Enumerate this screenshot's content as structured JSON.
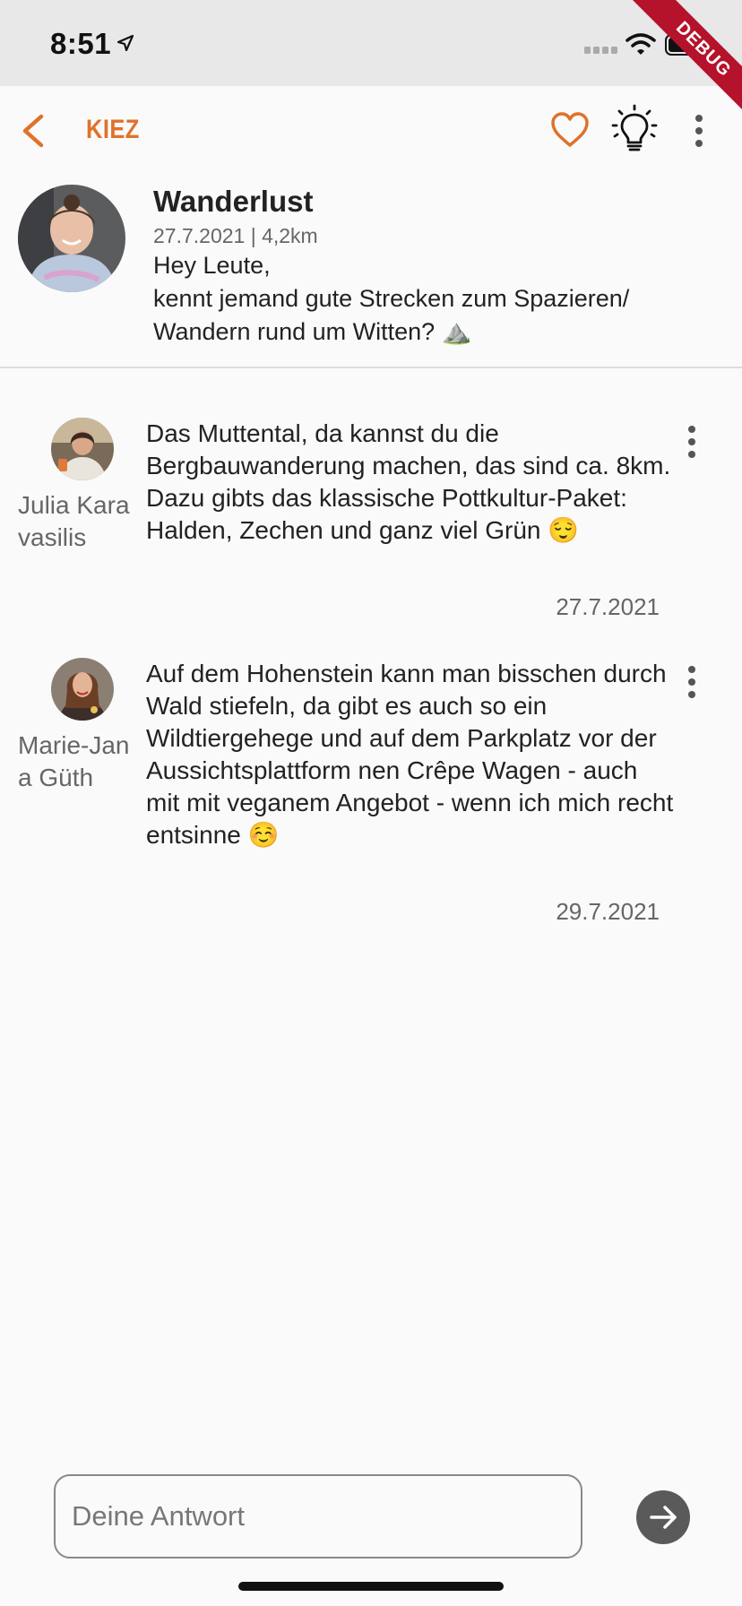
{
  "status_bar": {
    "time": "8:51",
    "debug_label": "DEBUG"
  },
  "app_bar": {
    "title": "KIEZ"
  },
  "post": {
    "title": "Wanderlust",
    "meta": "27.7.2021 | 4,2km",
    "body_line1": "Hey Leute,",
    "body_line2": "kennt jemand gute Strecken zum Spazieren/ Wandern rund um Witten? ⛰️"
  },
  "comments": [
    {
      "author": "Julia Karavasilis",
      "text": "Das Muttental, da kannst du die Bergbauwanderung machen, das sind ca. 8km. Dazu gibts das klassische Pottkultur-Paket: Halden, Zechen und ganz viel Grün 😌",
      "date": "27.7.2021"
    },
    {
      "author": "Marie-Jana Güth",
      "text": "Auf dem Hohenstein kann man bisschen durch Wald stiefeln, da gibt es auch so ein Wildtiergehege und auf dem Parkplatz vor der Aussichtsplattform nen Crêpe Wagen - auch mit mit veganem Angebot - wenn ich mich recht entsinne ☺️",
      "date": "29.7.2021"
    }
  ],
  "reply": {
    "placeholder": "Deine Antwort"
  },
  "colors": {
    "accent": "#e0722a",
    "background": "#fafafa",
    "status_bar": "#e8e8e8",
    "send_button": "#5a5a5a"
  }
}
